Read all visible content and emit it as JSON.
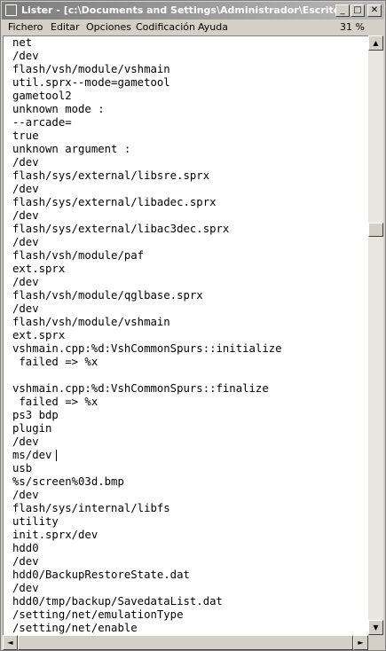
{
  "window": {
    "title": "Lister - [c:\\Documents and Settings\\Administrador\\Escritorio\\...",
    "controls": {
      "minimize": "_",
      "maximize": "□",
      "close": "✕"
    }
  },
  "menu": {
    "items": [
      "Fichero",
      "Editar",
      "Opciones",
      "Codificación",
      "Ayuda"
    ],
    "zoom": "31 %"
  },
  "content": {
    "lines": [
      "net",
      "/dev",
      "flash/vsh/module/vshmain",
      "util.sprx--mode=gametool",
      "gametool2",
      "unknown mode :",
      "--arcade=",
      "true",
      "unknown argument :",
      "/dev",
      "flash/sys/external/libsre.sprx",
      "/dev",
      "flash/sys/external/libadec.sprx",
      "/dev",
      "flash/sys/external/libac3dec.sprx",
      "/dev",
      "flash/vsh/module/paf",
      "ext.sprx",
      "/dev",
      "flash/vsh/module/qglbase.sprx",
      "/dev",
      "flash/vsh/module/vshmain",
      "ext.sprx",
      "vshmain.cpp:%d:VshCommonSpurs::initialize",
      " failed => %x",
      "",
      "vshmain.cpp:%d:VshCommonSpurs::finalize",
      " failed => %x",
      "ps3 bdp",
      "plugin",
      "/dev",
      "ms/dev",
      "usb",
      "%s/screen%03d.bmp",
      "/dev",
      "flash/sys/internal/libfs",
      "utility",
      "init.sprx/dev",
      "hdd0",
      "/dev",
      "hdd0/BackupRestoreState.dat",
      "/dev",
      "hdd0/tmp/backup/SavedataList.dat",
      "/setting/net/emulationType",
      "/setting/net/enable"
    ]
  },
  "scrollbar": {
    "up_arrow": "▲",
    "down_arrow": "▼",
    "left_arrow": "◄",
    "right_arrow": "►",
    "vertical_position": 0.31
  }
}
